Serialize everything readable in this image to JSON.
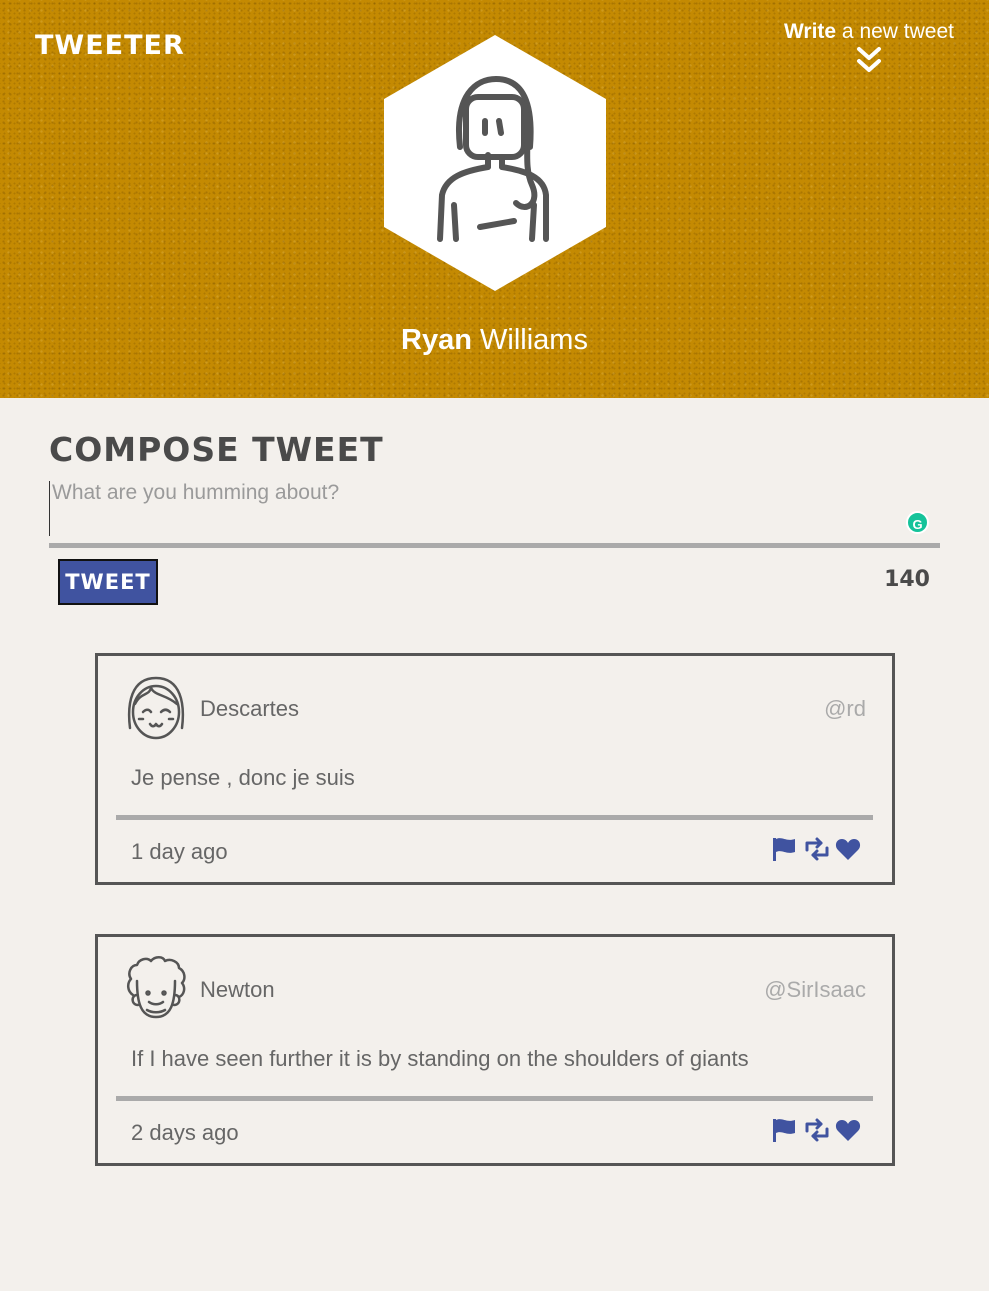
{
  "app": {
    "brand": "TWEETER"
  },
  "header": {
    "write_strong": "Write",
    "write_rest": " a new tweet",
    "user_first": "Ryan",
    "user_last": " Williams"
  },
  "compose": {
    "title": "COMPOSE TWEET",
    "placeholder": "What are you humming about?",
    "button_label": "TWEET",
    "counter": "140"
  },
  "tweets": [
    {
      "name": "Descartes",
      "handle": "@rd",
      "text": "Je pense , donc je suis",
      "time": "1 day ago"
    },
    {
      "name": "Newton",
      "handle": "@SirIsaac",
      "text": "If I have seen further it is by standing on the shoulders of giants",
      "time": "2 days ago"
    }
  ],
  "icons": {
    "flag": "flag-icon",
    "retweet": "retweet-icon",
    "like": "heart-icon",
    "write": "double-chevron-down-icon"
  },
  "colors": {
    "header_bg": "#c48a02",
    "page_bg": "#f3f0ec",
    "accent_blue": "#4053a0",
    "text_dark": "#4a4a4a",
    "grammarly": "#15c39a"
  }
}
